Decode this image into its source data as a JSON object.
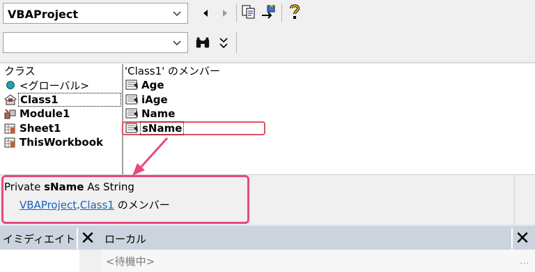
{
  "toolbar": {
    "project_combo": "VBAProject",
    "search_combo": "",
    "icons": [
      "chevron-down-icon",
      "back-icon",
      "forward-icon",
      "copy-icon",
      "view-definition-icon",
      "help-icon",
      "binoculars-icon",
      "expand-icon"
    ]
  },
  "classes": {
    "header": "クラス",
    "items": [
      {
        "label": "<グローバル>",
        "icon": "globe-icon"
      },
      {
        "label": "Class1",
        "icon": "class-module-icon"
      },
      {
        "label": "Module1",
        "icon": "module-icon"
      },
      {
        "label": "Sheet1",
        "icon": "sheet-object-icon"
      },
      {
        "label": "ThisWorkbook",
        "icon": "workbook-object-icon"
      }
    ]
  },
  "members": {
    "header": "'Class1' のメンバー",
    "items": [
      {
        "label": "Age",
        "icon": "property-icon"
      },
      {
        "label": "iAge",
        "icon": "property-icon"
      },
      {
        "label": "Name",
        "icon": "property-icon"
      },
      {
        "label": "sName",
        "icon": "property-icon"
      }
    ]
  },
  "detail": {
    "keyword_private": "Private",
    "member_name": "sName",
    "as_type": "As String",
    "project_link": "VBAProject",
    "dot": ".",
    "class_link": "Class1",
    "suffix": "のメンバー"
  },
  "immediate": {
    "title": "イミディエイト",
    "close": "✕"
  },
  "locals": {
    "title": "ローカル",
    "close": "✕",
    "status": "<待機中>",
    "more": "..."
  },
  "colors": {
    "highlight": "#e8487f",
    "link": "#1565c0",
    "panel_bar": "#cbd4de"
  }
}
